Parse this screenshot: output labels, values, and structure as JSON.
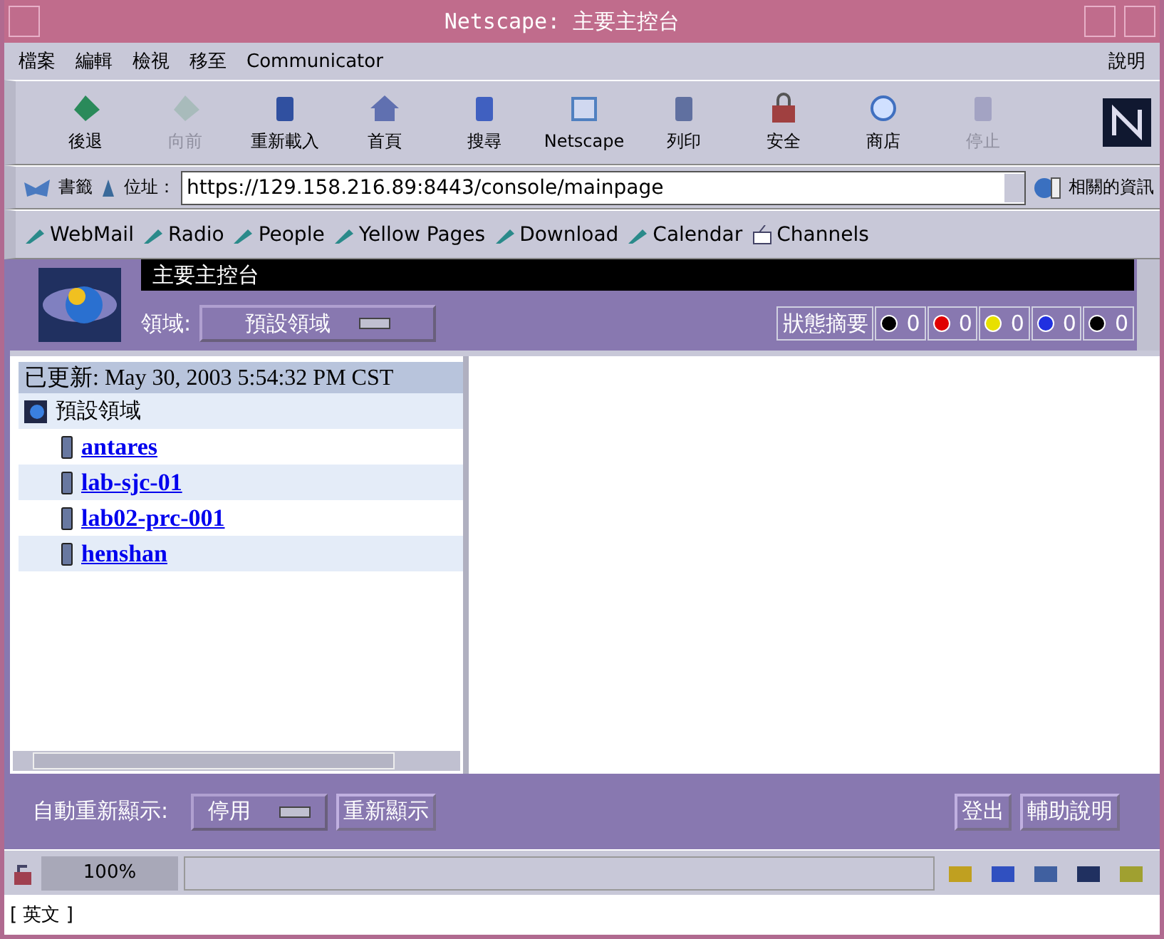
{
  "window": {
    "title": "Netscape: 主要主控台"
  },
  "menu": [
    {
      "label": "檔案"
    },
    {
      "label": "編輯"
    },
    {
      "label": "檢視"
    },
    {
      "label": "移至"
    },
    {
      "label": "Communicator"
    },
    {
      "label": "說明"
    }
  ],
  "toolbar": [
    {
      "label": "後退",
      "kind": "back",
      "disabled": false
    },
    {
      "label": "向前",
      "kind": "forward",
      "disabled": true
    },
    {
      "label": "重新載入",
      "kind": "reload",
      "disabled": false
    },
    {
      "label": "首頁",
      "kind": "home",
      "disabled": false
    },
    {
      "label": "搜尋",
      "kind": "search",
      "disabled": false
    },
    {
      "label": "Netscape",
      "kind": "my",
      "disabled": false
    },
    {
      "label": "列印",
      "kind": "print",
      "disabled": false
    },
    {
      "label": "安全",
      "kind": "lock",
      "disabled": false
    },
    {
      "label": "商店",
      "kind": "shop",
      "disabled": false
    },
    {
      "label": "停止",
      "kind": "stop",
      "disabled": true
    }
  ],
  "location": {
    "bookmarks": "書籤",
    "label": "位址：",
    "value": "https://129.158.216.89:8443/console/mainpage",
    "related": "相關的資訊"
  },
  "personal_bar": [
    {
      "label": "WebMail",
      "kind": "link"
    },
    {
      "label": "Radio",
      "kind": "link"
    },
    {
      "label": "People",
      "kind": "link"
    },
    {
      "label": "Yellow Pages",
      "kind": "link"
    },
    {
      "label": "Download",
      "kind": "link"
    },
    {
      "label": "Calendar",
      "kind": "link"
    },
    {
      "label": "Channels",
      "kind": "channel"
    }
  ],
  "console": {
    "title": "主要主控台",
    "domain_label": "領域:",
    "domain_value": "預設領域",
    "status_label": "狀態摘要",
    "status": [
      {
        "count": "0",
        "color": "#000000"
      },
      {
        "count": "0",
        "color": "#e00000"
      },
      {
        "count": "0",
        "color": "#e8e000"
      },
      {
        "count": "0",
        "color": "#2030e0"
      },
      {
        "count": "0",
        "color": "#000000"
      }
    ]
  },
  "tree": {
    "updated": "已更新: May 30, 2003 5:54:32 PM CST",
    "root": "預設領域",
    "children": [
      {
        "label": "antares"
      },
      {
        "label": "lab-sjc-01"
      },
      {
        "label": "lab02-prc-001"
      },
      {
        "label": "henshan"
      }
    ]
  },
  "footer": {
    "auto_label": "自動重新顯示:",
    "auto_value": "停用",
    "refresh": "重新顯示",
    "logout": "登出",
    "help": "輔助說明"
  },
  "status_bar": {
    "progress": "100%"
  },
  "ime": "[ 英文 ]"
}
